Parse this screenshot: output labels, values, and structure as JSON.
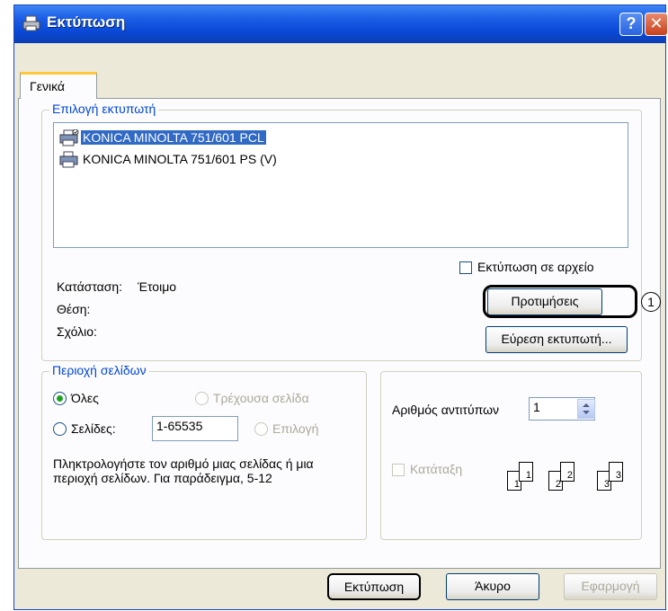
{
  "window": {
    "title": "Εκτύπωση",
    "help_glyph": "?",
    "close_glyph": "✕"
  },
  "tabs": [
    {
      "label": "Γενικά",
      "active": true
    }
  ],
  "printer_group": {
    "legend": "Επιλογή εκτυπωτή",
    "printers": [
      {
        "name": "KONICA MINOLTA 751/601 PCL",
        "selected": true,
        "default": true
      },
      {
        "name": "KONICA MINOLTA 751/601 PS (V)",
        "selected": false,
        "default": false
      }
    ],
    "status_label": "Κατάσταση:",
    "status_value": "Έτοιμο",
    "location_label": "Θέση:",
    "comment_label": "Σχόλιο:",
    "print_to_file_label": "Εκτύπωση σε αρχείο",
    "print_to_file_checked": false,
    "preferences_button": "Προτιμήσεις",
    "find_printer_button": "Εύρεση εκτυπωτή..."
  },
  "page_range_group": {
    "legend": "Περιοχή σελίδων",
    "all_label": "Όλες",
    "all_checked": true,
    "current_page_label": "Τρέχουσα σελίδα",
    "pages_label": "Σελίδες:",
    "pages_value": "1-65535",
    "selection_label": "Επιλογή",
    "hint": "Πληκτρολογήστε τον αριθμό μιας σελίδας ή μια περιοχή σελίδων.  Για παράδειγμα, 5-12"
  },
  "copies_group": {
    "copies_label": "Αριθμός αντιτύπων",
    "copies_value": "1",
    "collate_label": "Κατάταξη",
    "collate_checked": false,
    "collate_pages": [
      "1",
      "1",
      "2",
      "2",
      "3",
      "3"
    ]
  },
  "footer": {
    "print_button": "Εκτύπωση",
    "cancel_button": "Άκυρο",
    "apply_button": "Εφαρμογή"
  },
  "annotation": {
    "marker": "1"
  }
}
